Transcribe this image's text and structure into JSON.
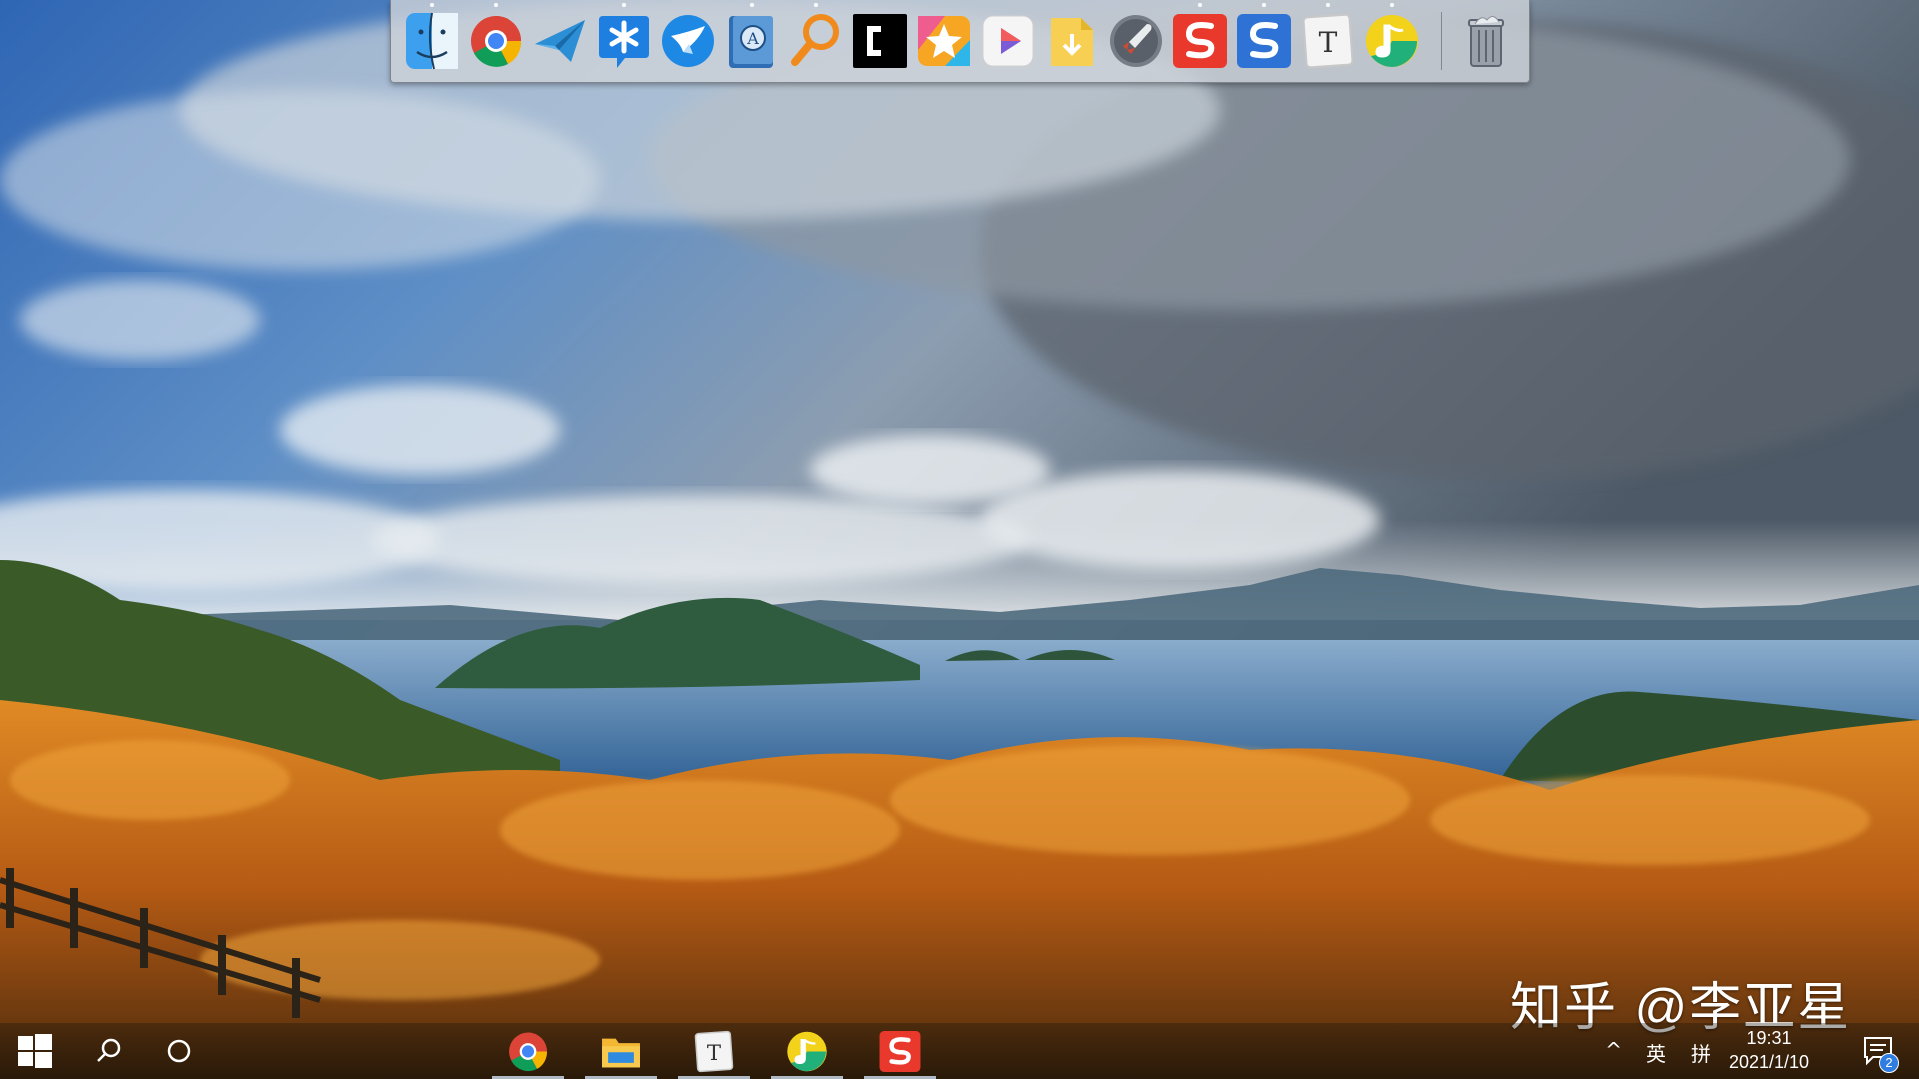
{
  "dock": {
    "apps": [
      {
        "name": "Finder",
        "icon": "finder-icon",
        "running": true
      },
      {
        "name": "Google Chrome",
        "icon": "chrome-icon",
        "running": true
      },
      {
        "name": "Telegram",
        "icon": "paper-plane-icon",
        "running": false
      },
      {
        "name": "Snipaste",
        "icon": "asterisk-bubble-icon",
        "running": true
      },
      {
        "name": "Feishu",
        "icon": "feishu-bird-icon",
        "running": false
      },
      {
        "name": "Dictionary",
        "icon": "dictionary-icon",
        "running": true
      },
      {
        "name": "Everything",
        "icon": "magnifier-icon",
        "running": true
      },
      {
        "name": "Terminal",
        "icon": "terminal-icon",
        "running": false
      },
      {
        "name": "Photos",
        "icon": "star-photos-icon",
        "running": false
      },
      {
        "name": "Video Player",
        "icon": "play-icon",
        "running": false
      },
      {
        "name": "Downloads",
        "icon": "download-folder-icon",
        "running": false
      },
      {
        "name": "Launchpad",
        "icon": "rocket-icon",
        "running": false
      },
      {
        "name": "WPS Spreadsheets",
        "icon": "wps-red-icon",
        "running": true
      },
      {
        "name": "WPS Writer",
        "icon": "wps-blue-icon",
        "running": true
      },
      {
        "name": "Typora",
        "icon": "typora-icon",
        "running": true
      },
      {
        "name": "QQ Music",
        "icon": "qq-music-icon",
        "running": true
      }
    ],
    "trash": {
      "name": "Trash",
      "icon": "trash-icon"
    }
  },
  "watermark": "知乎 @李亚星",
  "taskbar": {
    "start_icon": "windows-logo-icon",
    "search_icon": "search-icon",
    "cortana_icon": "cortana-circle-icon",
    "pinned": [
      {
        "name": "Google Chrome",
        "icon": "chrome-icon",
        "running": true
      },
      {
        "name": "File Explorer",
        "icon": "folder-icon",
        "running": true
      },
      {
        "name": "Typora",
        "icon": "typora-icon",
        "running": true
      },
      {
        "name": "QQ Music",
        "icon": "qq-music-icon",
        "running": true
      },
      {
        "name": "WPS",
        "icon": "wps-red-icon",
        "running": true
      }
    ],
    "tray": {
      "chevron": "^",
      "input_lang": "英",
      "input_mode": "拼",
      "time": "19:31",
      "date": "2021/1/10",
      "notification_count": "2"
    }
  },
  "colors": {
    "sky": "#3f6ea6",
    "cloud": "#e6eaee",
    "lake": "#3c6f9c",
    "foliage": "#d6781e",
    "accent_blue": "#2f7de1"
  }
}
